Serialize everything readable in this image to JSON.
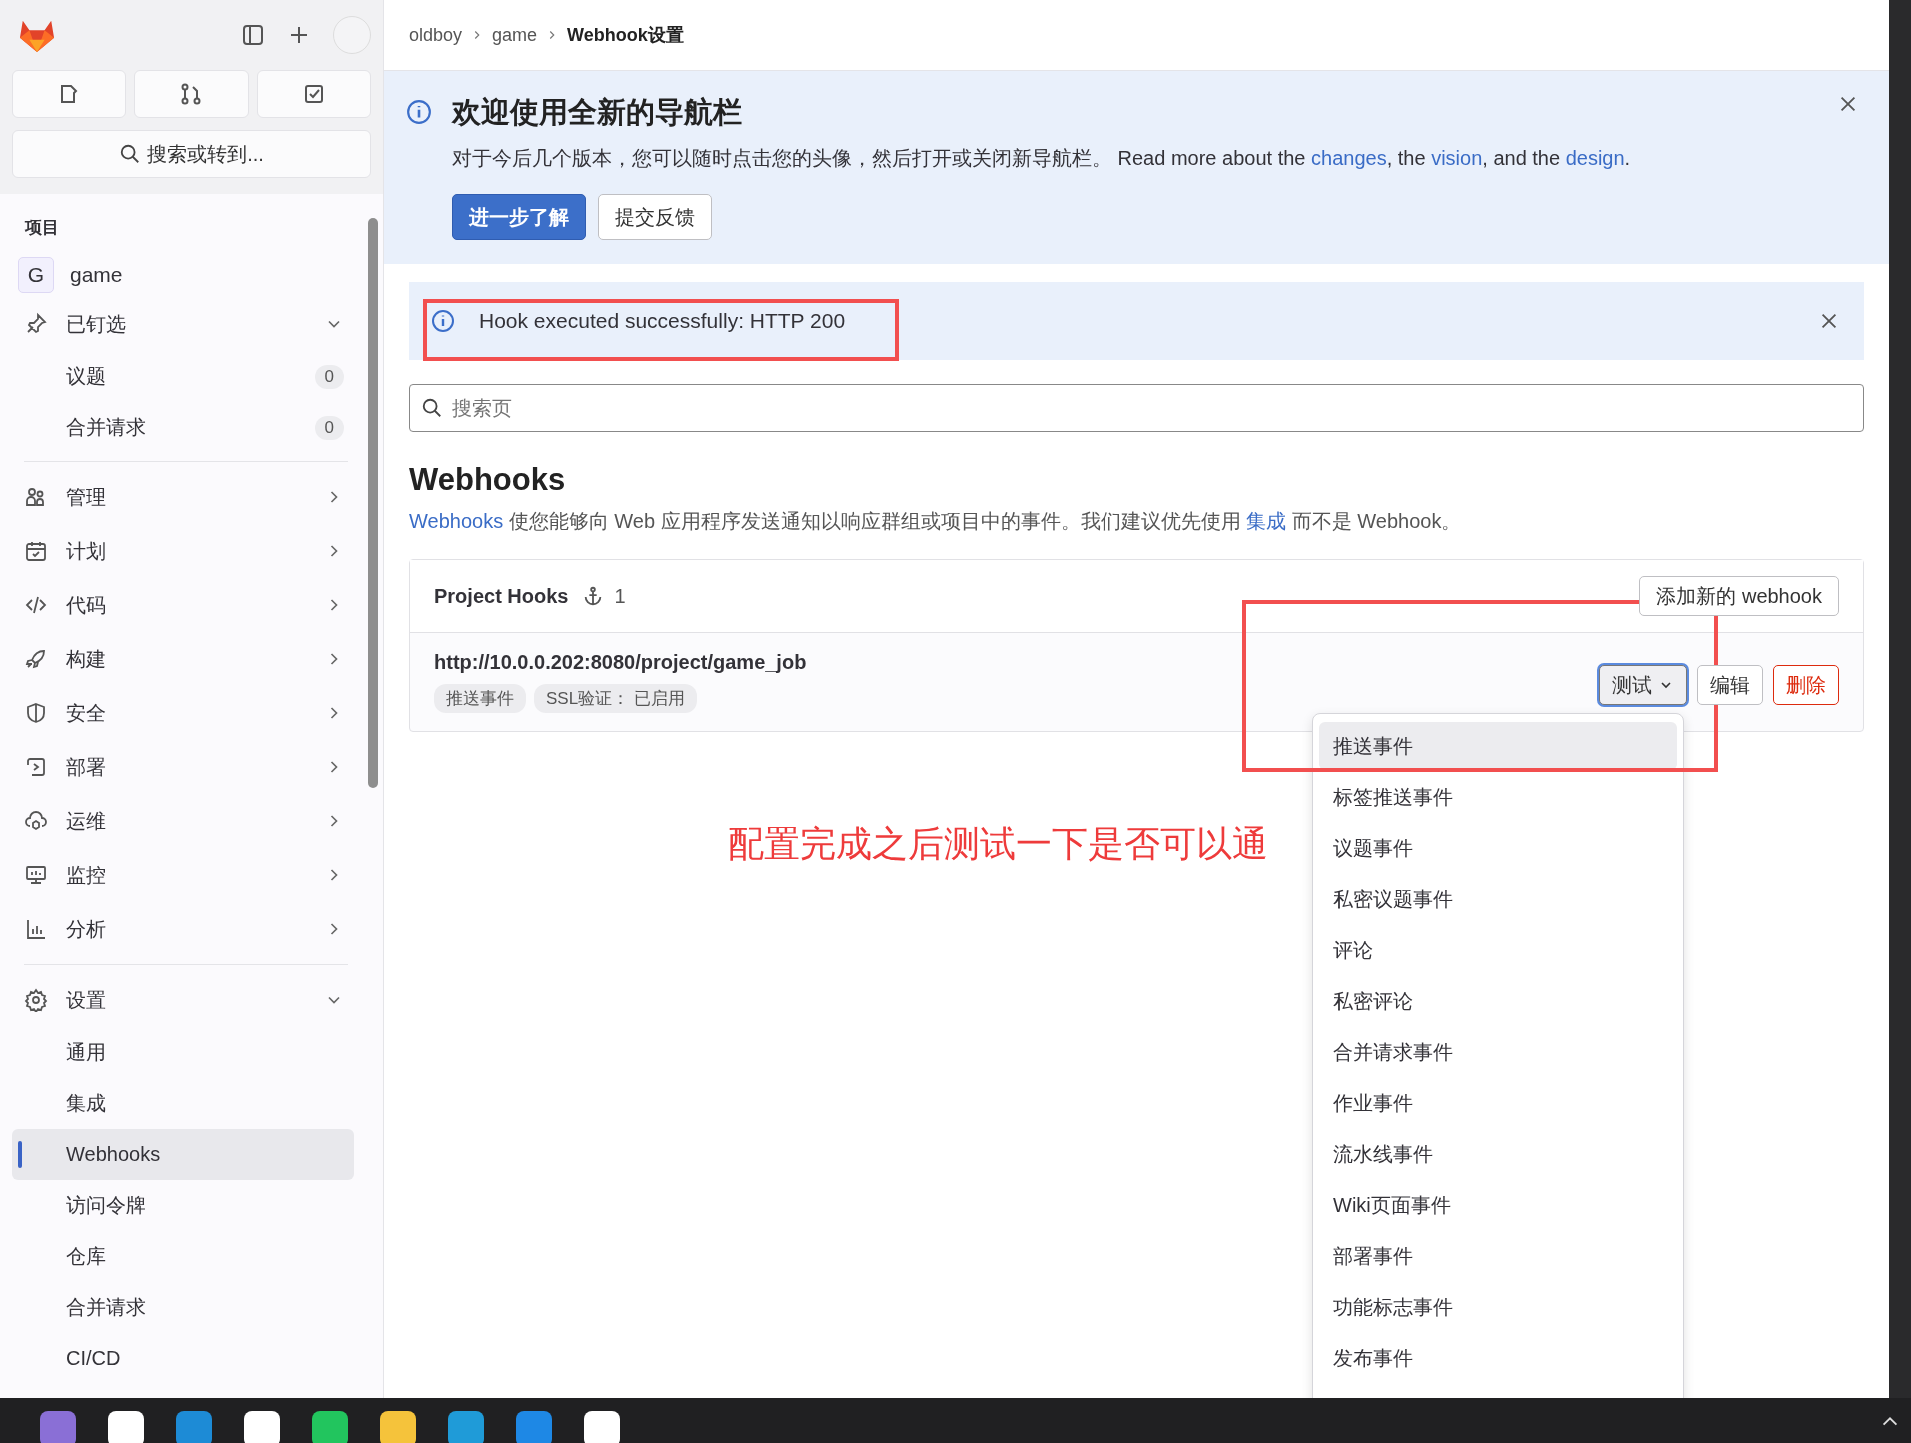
{
  "sidebar": {
    "search": "搜索或转到...",
    "section_label": "项目",
    "project": {
      "avatar": "G",
      "name": "game"
    },
    "sections": [
      [
        {
          "label": "已钉选",
          "expanded": true,
          "children": [
            {
              "label": "议题",
              "count": "0",
              "selected": false
            },
            {
              "label": "合并请求",
              "count": "0",
              "selected": false
            }
          ]
        }
      ],
      [
        {
          "label": "管理",
          "expanded": false
        },
        {
          "label": "计划",
          "expanded": false
        },
        {
          "label": "代码",
          "expanded": false
        },
        {
          "label": "构建",
          "expanded": false
        },
        {
          "label": "安全",
          "expanded": false
        },
        {
          "label": "部署",
          "expanded": false
        },
        {
          "label": "运维",
          "expanded": false
        },
        {
          "label": "监控",
          "expanded": false
        },
        {
          "label": "分析",
          "expanded": false
        }
      ],
      [
        {
          "label": "设置",
          "expanded": true,
          "children": [
            {
              "label": "通用",
              "selected": false
            },
            {
              "label": "集成",
              "selected": false
            },
            {
              "label": "Webhooks",
              "selected": true
            },
            {
              "label": "访问令牌",
              "selected": false
            },
            {
              "label": "仓库",
              "selected": false
            },
            {
              "label": "合并请求",
              "selected": false
            },
            {
              "label": "CI/CD",
              "selected": false
            }
          ]
        }
      ]
    ]
  },
  "breadcrumb": [
    "oldboy",
    "game",
    "Webhook设置"
  ],
  "banner": {
    "title": "欢迎使用全新的导航栏",
    "text": [
      {
        "text": "对于今后几个版本，您可以随时点击您的头像，然后打开或关闭新导航栏。 Read more about the ",
        "link": false
      },
      {
        "text": "changes",
        "link": true
      },
      {
        "text": ", the ",
        "link": false
      },
      {
        "text": "vision",
        "link": true
      },
      {
        "text": ", and the ",
        "link": false
      },
      {
        "text": "design",
        "link": true
      },
      {
        "text": ".",
        "link": false
      }
    ],
    "buttons": [
      {
        "label": "进一步了解",
        "kind": "primary"
      },
      {
        "label": "提交反馈",
        "kind": "default"
      }
    ]
  },
  "alert": {
    "message": "Hook executed successfully: HTTP 200"
  },
  "search": {
    "placeholder": "搜索页"
  },
  "heading": "Webhooks",
  "description": [
    {
      "text": "Webhooks",
      "link": true
    },
    {
      "text": " 使您能够向 Web 应用程序发送通知以响应群组或项目中的事件。我们建议优先使用 ",
      "link": false
    },
    {
      "text": "集成",
      "link": true
    },
    {
      "text": " 而不是 Webhook。",
      "link": false
    }
  ],
  "hooks": {
    "title": "Project Hooks",
    "count": "1",
    "add_button": "添加新的 webhook",
    "items": [
      {
        "url": "http://10.0.0.202:8080/project/game_job",
        "tags": [
          "推送事件",
          "SSL验证： 已启用"
        ],
        "actions": [
          {
            "label": "测试",
            "kind": "dropdown",
            "expanded": true
          },
          {
            "label": "编辑",
            "kind": "default"
          },
          {
            "label": "删除",
            "kind": "danger"
          }
        ]
      }
    ]
  },
  "test_menu": [
    {
      "label": "推送事件",
      "selected": true
    },
    {
      "label": "标签推送事件",
      "selected": false
    },
    {
      "label": "议题事件",
      "selected": false
    },
    {
      "label": "私密议题事件",
      "selected": false
    },
    {
      "label": "评论",
      "selected": false
    },
    {
      "label": "私密评论",
      "selected": false
    },
    {
      "label": "合并请求事件",
      "selected": false
    },
    {
      "label": "作业事件",
      "selected": false
    },
    {
      "label": "流水线事件",
      "selected": false
    },
    {
      "label": "Wiki页面事件",
      "selected": false
    },
    {
      "label": "部署事件",
      "selected": false
    },
    {
      "label": "功能标志事件",
      "selected": false
    },
    {
      "label": "发布事件",
      "selected": false
    }
  ],
  "annotation": {
    "note": "配置完成之后测试一下是否可以通"
  }
}
